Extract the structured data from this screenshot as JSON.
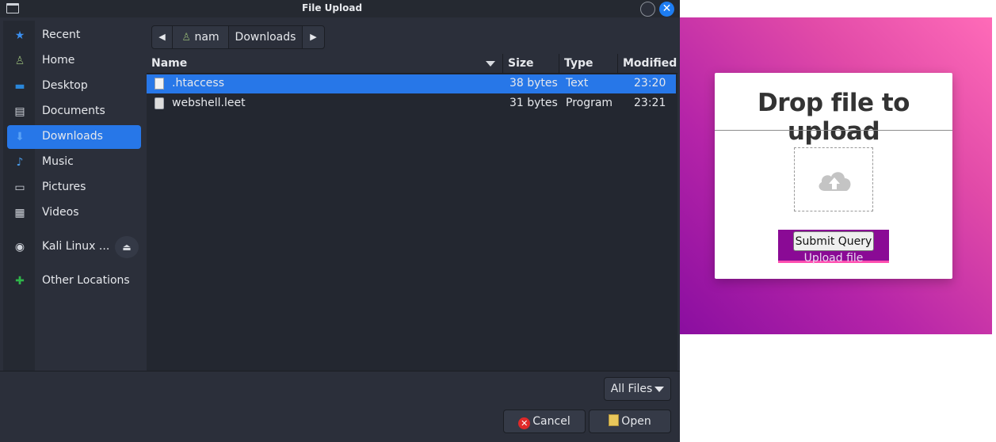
{
  "dialog": {
    "title": "File Upload",
    "close_glyph": "✕"
  },
  "sidebar": {
    "items": [
      {
        "label": "Recent",
        "icon": "star-icon",
        "glyph": "★"
      },
      {
        "label": "Home",
        "icon": "home-user-icon",
        "glyph": "♙"
      },
      {
        "label": "Desktop",
        "icon": "desktop-icon",
        "glyph": "▬"
      },
      {
        "label": "Documents",
        "icon": "document-icon",
        "glyph": "▤"
      },
      {
        "label": "Downloads",
        "icon": "download-arrow-icon",
        "glyph": "⬇",
        "active": true
      },
      {
        "label": "Music",
        "icon": "music-note-icon",
        "glyph": "♪"
      },
      {
        "label": "Pictures",
        "icon": "picture-icon",
        "glyph": "▭"
      },
      {
        "label": "Videos",
        "icon": "film-icon",
        "glyph": "▦"
      },
      {
        "label": "Kali Linux ...",
        "icon": "disc-icon",
        "glyph": "◉"
      },
      {
        "label": "Other Locations",
        "icon": "plus-icon",
        "glyph": "✚"
      }
    ],
    "eject_glyph": "⏏"
  },
  "pathbar": {
    "back_glyph": "◀",
    "forward_glyph": "▶",
    "segments": [
      "nam",
      "Downloads"
    ]
  },
  "filelist": {
    "columns": [
      "Name",
      "Size",
      "Type",
      "Modified"
    ],
    "rows": [
      {
        "name": ".htaccess",
        "size": "38 bytes",
        "type": "Text",
        "modified": "23:20",
        "selected": true
      },
      {
        "name": "webshell.leet",
        "size": "31 bytes",
        "type": "Program",
        "modified": "23:21",
        "selected": false
      }
    ]
  },
  "filter": {
    "label": "All Files"
  },
  "buttons": {
    "cancel": "Cancel",
    "open": "Open",
    "cancel_glyph": "✕"
  },
  "webpage": {
    "heading": "Drop file to upload",
    "submit_label": "Submit Query",
    "upload_label": "Upload file",
    "gradient_colors": [
      "#8a0ea0",
      "#ff6bb8"
    ]
  },
  "colors": {
    "accent": "#2777e8",
    "dialog_bg": "#2b2f3a"
  }
}
